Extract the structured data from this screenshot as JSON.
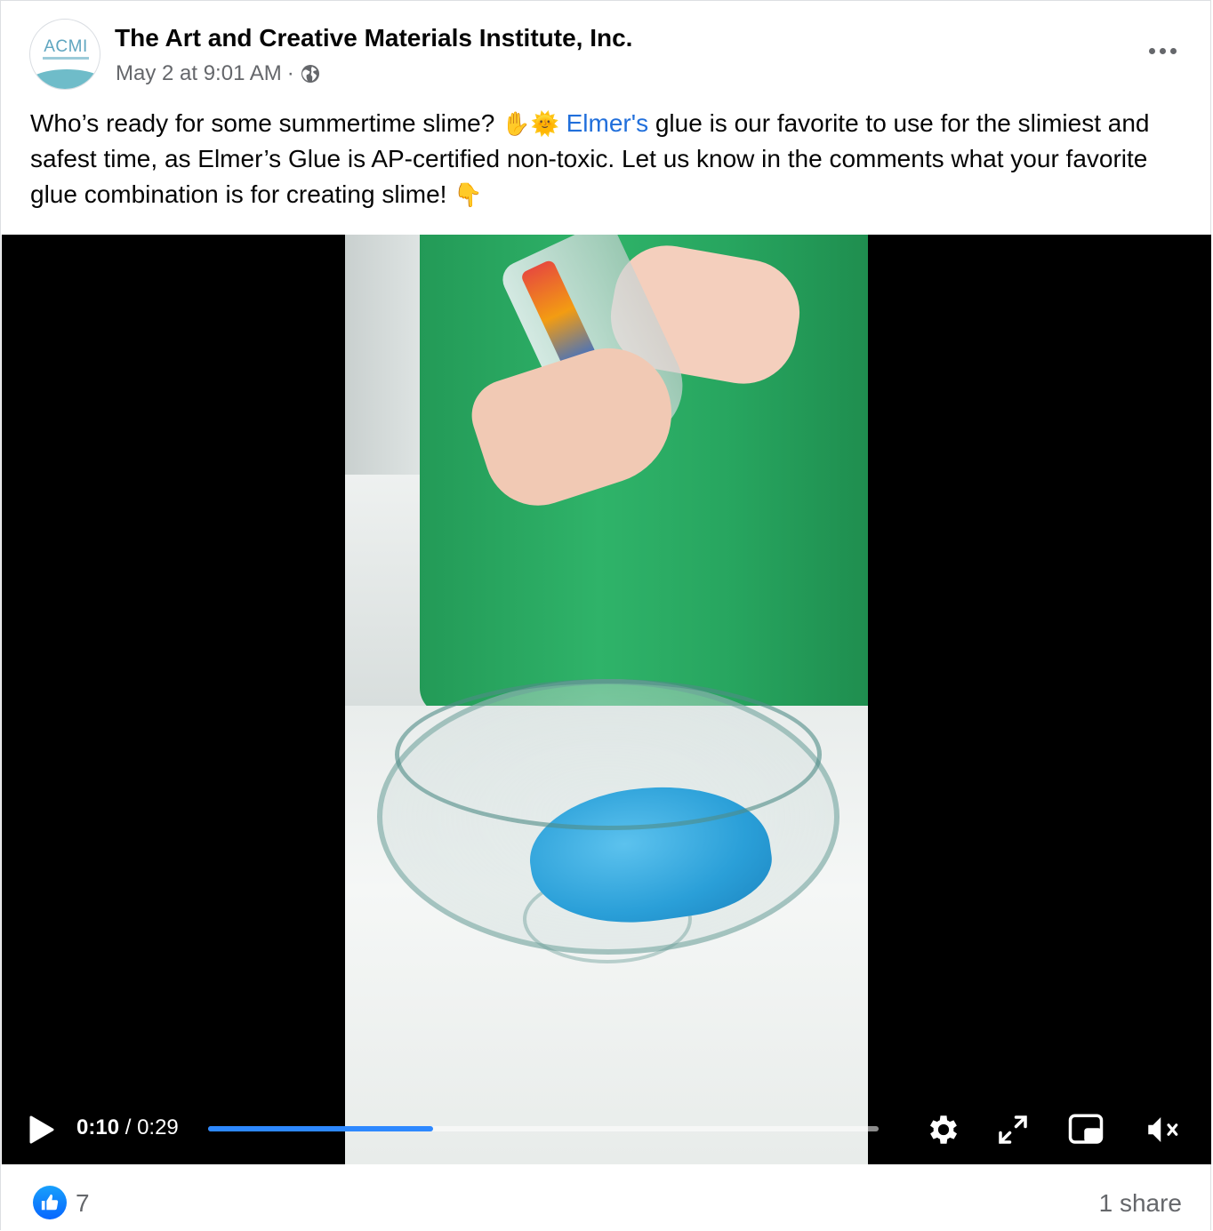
{
  "post": {
    "page_name": "The Art and Creative Materials Institute, Inc.",
    "avatar_text": "ACMI",
    "timestamp": "May 2 at 9:01 AM",
    "separator": "·",
    "privacy_icon": "globe-icon",
    "more_icon": "more-dots-icon",
    "text_part1": "Who’s ready for some summertime slime? ",
    "emoji_hand": "✋",
    "emoji_sun": "🌞",
    "mention": "Elmer's",
    "text_part2": " glue is our favorite to use for the slimiest and safest time, as Elmer’s Glue is AP-certified non-toxic. Let us know in the comments what your favorite glue combination is for creating slime! ",
    "emoji_point": "👇"
  },
  "video": {
    "current_time": "0:10",
    "time_separator": " / ",
    "duration": "0:29",
    "progress_fraction": 0.335,
    "progress_color": "#2d88ff",
    "icons": [
      "play-icon",
      "settings-gear-icon",
      "fullscreen-icon",
      "picture-in-picture-icon",
      "muted-speaker-icon"
    ]
  },
  "footer": {
    "like_icon": "thumbs-up-icon",
    "like_count": "7",
    "share_count": "1 share",
    "accent": "#0866ff"
  }
}
